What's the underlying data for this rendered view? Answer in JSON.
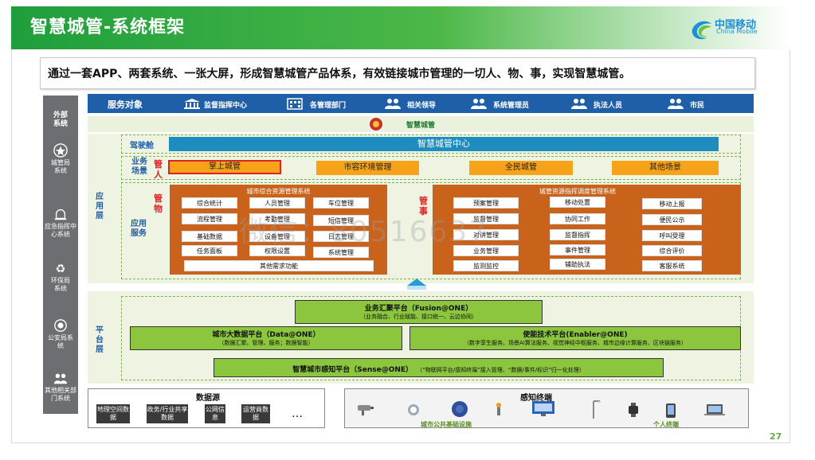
{
  "title": "智慧城管-系统框架",
  "logo": {
    "cn": "中国移动",
    "en": "China Mobile"
  },
  "subtitle": "通过一套APP、两套系统、一张大屏，形成智慧城管产品体系，有效链接城市管理的一切人、物、事，实现智慧城管。",
  "left_column": [
    "外部系统",
    "城管局系统",
    "应急指挥中心系统",
    "环保局系统",
    "公安局系统",
    "其他相关部门系统"
  ],
  "service": {
    "label": "服务对象",
    "items": [
      "监督指挥中心",
      "各管理部门",
      "相关领导",
      "系统管理员",
      "执法人员",
      "市民"
    ]
  },
  "system_name": "智慧城管",
  "layers": {
    "app": "应用层",
    "platform": "平台层"
  },
  "cockpit": {
    "label": "驾驶舱",
    "bar": "智慧城管中心"
  },
  "scenario": {
    "label": "业务场景",
    "manage": "管人",
    "items": [
      "掌上城管",
      "市容环境管理",
      "全民城管",
      "其他场景"
    ]
  },
  "app_service": {
    "label": "应用服务",
    "things_label": "管物",
    "affairs_label": "管事",
    "left_system": {
      "title": "城市综合资源管理系统",
      "items": [
        "综合统计",
        "人员管理",
        "车位管理",
        "流程管理",
        "考勤管理",
        "短信管理",
        "基础数据",
        "设备管理",
        "日志管理",
        "任务面板",
        "权限设置",
        "系统管理"
      ],
      "other": "其他需求功能"
    },
    "right_system": {
      "title": "城管资源指挥调度管理系统",
      "col1": [
        "预案管理",
        "监督管理",
        "对讲管理",
        "业务管理",
        "监测监控"
      ],
      "col2": [
        "移动处置",
        "协同工作",
        "监督指挥",
        "事件管理",
        "辅助执法"
      ],
      "col3": [
        "移动上报",
        "便民公示",
        "呼叫受理",
        "综合评价",
        "客服系统"
      ]
    }
  },
  "platform": {
    "fusion": {
      "title": "业务汇聚平台（Fusion@ONE）",
      "sub": "（业务融合、行业赋能、接口统一、云边协同）"
    },
    "data": {
      "title": "城市大数据平台（Data@ONE）",
      "sub": "（数据汇聚、管理、服务；数据智能）"
    },
    "enabler": {
      "title": "使能技术平台(Enabler@ONE)",
      "sub": "（数字孪生服务、场景AI算法服务、视觉神经中枢服务、城市边缘计算服务、区块链服务）"
    },
    "sense": {
      "title": "智慧城市感知平台（Sense@ONE）",
      "sub": "（“物联网平台/感知终端”接入管理、“数据/事件/标识”归一化处理）"
    }
  },
  "data_source": {
    "title": "数据源",
    "items": [
      "地理空间数据",
      "政务/行业共享数据",
      "公网信息",
      "运营商数据"
    ],
    "more": "…"
  },
  "terminals": {
    "title": "感知终端",
    "city_label": "城市公共基础设施",
    "personal_label": "个人终端"
  },
  "page_number": "27",
  "watermark": "微信：80516637"
}
